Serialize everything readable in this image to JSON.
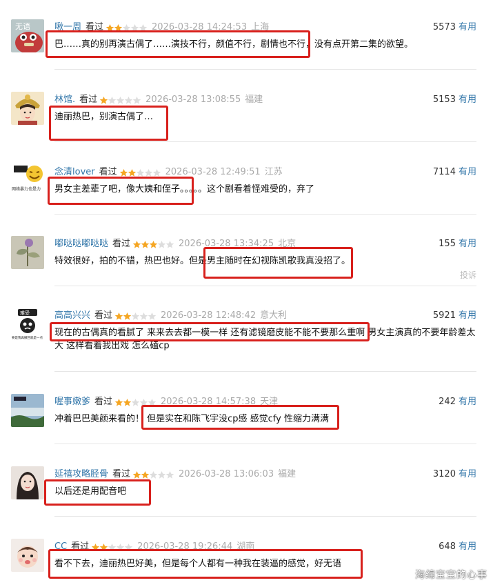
{
  "colors": {
    "username": "#3377aa",
    "star_on": "#f5a623",
    "star_off": "#dddddd",
    "highlight": "#d8201c"
  },
  "icons": {
    "star": "star-icon"
  },
  "comments": [
    {
      "user": "啾一周",
      "status": "看过",
      "rating": 2,
      "date": "2026-03-28 14:24:53",
      "location": "上海",
      "votes": "5573",
      "vote_label": "有用",
      "text": "巴……真的别再演古偶了……演技不行，颜值不行，剧情也不行，没有点开第二集的欲望。",
      "avatar_label": "无语"
    },
    {
      "user": "林馆.",
      "status": "看过",
      "rating": 1,
      "date": "2026-03-28 13:08:55",
      "location": "福建",
      "votes": "5153",
      "vote_label": "有用",
      "text": "迪丽热巴，别演古偶了…"
    },
    {
      "user": "念清lover",
      "status": "看过",
      "rating": 2,
      "date": "2026-03-28 12:49:51",
      "location": "江苏",
      "votes": "7114",
      "vote_label": "有用",
      "text": "男女主差辈了吧，像大姨和侄子。。。。。这个剧看着怪难受的，弃了",
      "avatar_label": "网络暴力也是力"
    },
    {
      "user": "嘟哒哒嘟哒哒",
      "status": "看过",
      "rating": 3,
      "date": "2026-03-28 13:34:25",
      "location": "北京",
      "votes": "155",
      "vote_label": "有用",
      "text": "特效很好，拍的不错，热巴也好。但是男主随时在幻视陈凯歌我真没招了。",
      "report": "投诉"
    },
    {
      "user": "高高兴兴",
      "status": "看过",
      "rating": 2,
      "date": "2026-03-28 12:48:42",
      "location": "意大利",
      "votes": "5921",
      "vote_label": "有用",
      "text": "现在的古偶真的看腻了 来来去去都一模一样 还有滤镜磨皮能不能不要那么重啊 男女主演真的不要年龄差太大 这样看着我出戏 怎么磕cp",
      "avatar_label": "难受",
      "avatar_caption": "要是我再撤回就是一点"
    },
    {
      "user": "喔事嫩爹",
      "status": "看过",
      "rating": 2,
      "date": "2026-03-28 14:57:38",
      "location": "天津",
      "votes": "242",
      "vote_label": "有用",
      "text": "冲着巴巴美颜来看的！ 但是实在和陈飞宇没cp感 感觉cfy 性缩力满满"
    },
    {
      "user": "延禧攻略胫骨",
      "status": "看过",
      "rating": 2,
      "date": "2026-03-28 13:06:03",
      "location": "福建",
      "votes": "3120",
      "vote_label": "有用",
      "text": "以后还是用配音吧"
    },
    {
      "user": "CC",
      "status": "看过",
      "rating": 2,
      "date": "2026-03-28 19:26:44",
      "location": "湖南",
      "votes": "648",
      "vote_label": "有用",
      "text": "看不下去，迪丽热巴好美，但是每个人都有一种我在装逼的感觉，好无语"
    }
  ],
  "watermark": "海绵宝宝的心事"
}
